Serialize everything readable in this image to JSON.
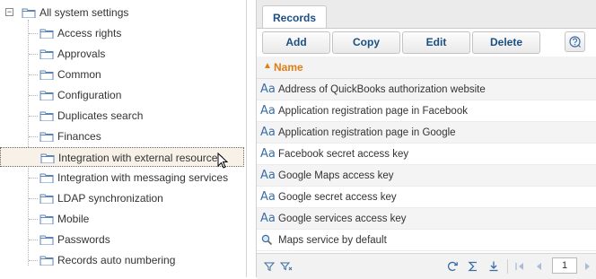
{
  "tree": {
    "root_toggle": "−",
    "root_label": "All system settings",
    "items": [
      {
        "label": "Access rights"
      },
      {
        "label": "Approvals"
      },
      {
        "label": "Common"
      },
      {
        "label": "Configuration"
      },
      {
        "label": "Duplicates search"
      },
      {
        "label": "Finances"
      },
      {
        "label": "Integration with external resources",
        "selected": true
      },
      {
        "label": "Integration with messaging services"
      },
      {
        "label": "LDAP synchronization"
      },
      {
        "label": "Mobile"
      },
      {
        "label": "Passwords"
      },
      {
        "label": "Records auto numbering"
      }
    ]
  },
  "tab": {
    "label": "Records"
  },
  "toolbar": {
    "add_label": "Add",
    "copy_label": "Copy",
    "edit_label": "Edit",
    "delete_label": "Delete",
    "help_icon": "help-icon"
  },
  "grid": {
    "column_header": "Name",
    "sort_direction": "ascending",
    "rows": [
      {
        "type_icon": "Aa",
        "name": "Address of QuickBooks authorization website"
      },
      {
        "type_icon": "Aa",
        "name": "Application registration page in Facebook"
      },
      {
        "type_icon": "Aa",
        "name": "Application registration page in Google"
      },
      {
        "type_icon": "Aa",
        "name": "Facebook secret access key"
      },
      {
        "type_icon": "Aa",
        "name": "Google Maps access key"
      },
      {
        "type_icon": "Aa",
        "name": "Google secret access key"
      },
      {
        "type_icon": "Aa",
        "name": "Google services access key"
      },
      {
        "type_icon": "lookup",
        "name": "Maps service by default"
      }
    ]
  },
  "footer": {
    "page_number": "1"
  },
  "colors": {
    "accent_blue": "#1a4f84",
    "sort_orange": "#e07d17",
    "folder_blue": "#5b85b5"
  }
}
